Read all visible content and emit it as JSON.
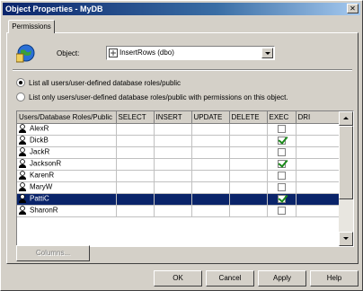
{
  "window": {
    "title": "Object Properties - MyDB"
  },
  "tabs": [
    {
      "label": "Permissions"
    }
  ],
  "object": {
    "label": "Object:",
    "value": "InsertRows (dbo)"
  },
  "radios": [
    {
      "label": "List all users/user-defined database roles/public",
      "selected": true
    },
    {
      "label": "List only users/user-defined database roles/public with permissions on this object.",
      "selected": false
    }
  ],
  "grid": {
    "columns": [
      "Users/Database Roles/Public",
      "SELECT",
      "INSERT",
      "UPDATE",
      "DELETE",
      "EXEC",
      "DRI"
    ],
    "rows": [
      {
        "name": "AlexR",
        "exec": false,
        "selected": false
      },
      {
        "name": "DickB",
        "exec": true,
        "selected": false
      },
      {
        "name": "JackR",
        "exec": false,
        "selected": false
      },
      {
        "name": "JacksonR",
        "exec": true,
        "selected": false
      },
      {
        "name": "KarenR",
        "exec": false,
        "selected": false
      },
      {
        "name": "MaryW",
        "exec": false,
        "selected": false
      },
      {
        "name": "PattiC",
        "exec": true,
        "selected": true
      },
      {
        "name": "SharonR",
        "exec": false,
        "selected": false
      }
    ]
  },
  "buttons": {
    "columns": "Columns...",
    "ok": "OK",
    "cancel": "Cancel",
    "apply": "Apply",
    "help": "Help"
  },
  "icons": {
    "object": "database-object-icon",
    "user": "user-icon",
    "check": "green-check-icon"
  },
  "colors": {
    "title_bar": "#0a246a",
    "selection": "#0a246a",
    "check": "#1a8a1a"
  }
}
